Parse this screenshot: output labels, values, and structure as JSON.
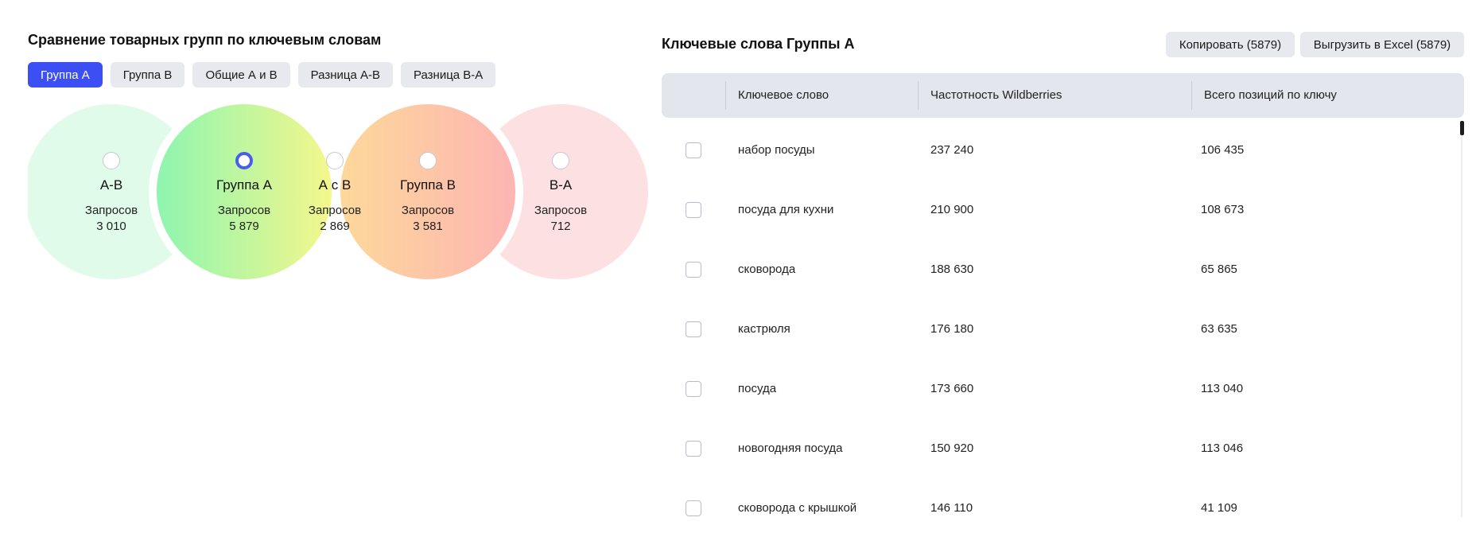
{
  "left": {
    "title": "Сравнение товарных групп по ключевым словам",
    "tabs": [
      {
        "label": "Группа А",
        "active": true
      },
      {
        "label": "Группа B",
        "active": false
      },
      {
        "label": "Общие А и B",
        "active": false
      },
      {
        "label": "Разница А-B",
        "active": false
      },
      {
        "label": "Разница B-А",
        "active": false
      }
    ],
    "venn": [
      {
        "name": "А-В",
        "metric": "Запросов",
        "count": "3 010",
        "selected": false
      },
      {
        "name": "Группа А",
        "metric": "Запросов",
        "count": "5 879",
        "selected": true
      },
      {
        "name": "А с В",
        "metric": "Запросов",
        "count": "2 869",
        "selected": false
      },
      {
        "name": "Группа В",
        "metric": "Запросов",
        "count": "3 581",
        "selected": false
      },
      {
        "name": "В-А",
        "metric": "Запросов",
        "count": "712",
        "selected": false
      }
    ],
    "colors": {
      "accent": "#3b4ff5",
      "a_only": "#e1fbea",
      "b_only": "#fde0e2",
      "group_a_gradient": [
        "#8ef5b0",
        "#f2f58a"
      ],
      "group_b_gradient": [
        "#fdd69a",
        "#fdb5b3"
      ]
    }
  },
  "right": {
    "title": "Ключевые слова Группы А",
    "copy_button": "Копировать (5879)",
    "export_button": "Выгрузить в Excel (5879)",
    "columns": [
      "Ключевое слово",
      "Частотность Wildberries",
      "Всего позиций по ключу"
    ],
    "rows": [
      {
        "keyword": "набор посуды",
        "frequency": "237 240",
        "positions": "106 435"
      },
      {
        "keyword": "посуда для кухни",
        "frequency": "210 900",
        "positions": "108 673"
      },
      {
        "keyword": "сковорода",
        "frequency": "188 630",
        "positions": "65 865"
      },
      {
        "keyword": "кастрюля",
        "frequency": "176 180",
        "positions": "63 635"
      },
      {
        "keyword": "посуда",
        "frequency": "173 660",
        "positions": "113 040"
      },
      {
        "keyword": "новогодняя посуда",
        "frequency": "150 920",
        "positions": "113 046"
      },
      {
        "keyword": "сковорода с крышкой",
        "frequency": "146 110",
        "positions": "41 109"
      }
    ]
  }
}
